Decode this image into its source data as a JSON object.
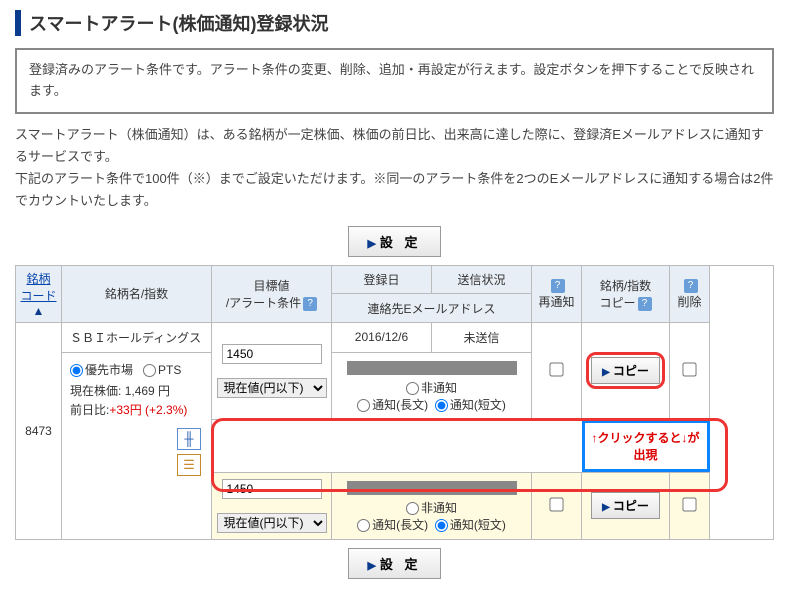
{
  "page_title": "スマートアラート(株価通知)登録状況",
  "info_box": "登録済みのアラート条件です。アラート条件の変更、削除、追加・再設定が行えます。設定ボタンを押下することで反映されます。",
  "description": "スマートアラート（株価通知）は、ある銘柄が一定株価、株価の前日比、出来高に達した際に、登録済Eメールアドレスに通知するサービスです。\n下記のアラート条件で100件（※）までご設定いただけます。※同一のアラート条件を2つのEメールアドレスに通知する場合は2件でカウントいたします。",
  "buttons": {
    "settei": "設 定",
    "copy": "コピー"
  },
  "headers": {
    "code": "銘柄\nコード",
    "name": "銘柄名/指数",
    "target": "目標値\n/アラート条件",
    "reg_date": "登録日",
    "send_status": "送信状況",
    "email": "連絡先Eメールアドレス",
    "renotify": "再通知",
    "copy": "銘柄/指数\nコピー",
    "delete": "削除"
  },
  "row": {
    "code": "8473",
    "name": "ＳＢＩホールディングス",
    "market_opt1": "優先市場",
    "market_opt2": "PTS",
    "price_label": "現在株価:",
    "price_value": "1,469 円",
    "diff_label": "前日比:",
    "diff_value": "+33円",
    "diff_pct": "(+2.3%)",
    "target_value": "1450",
    "cond_value": "現在値(円以下)",
    "reg_date": "2016/12/6",
    "status": "未送信",
    "notify_none": "非通知",
    "notify_long": "通知(長文)",
    "notify_short": "通知(短文)"
  },
  "callout": "↑クリックすると↓が出現",
  "help": "?"
}
